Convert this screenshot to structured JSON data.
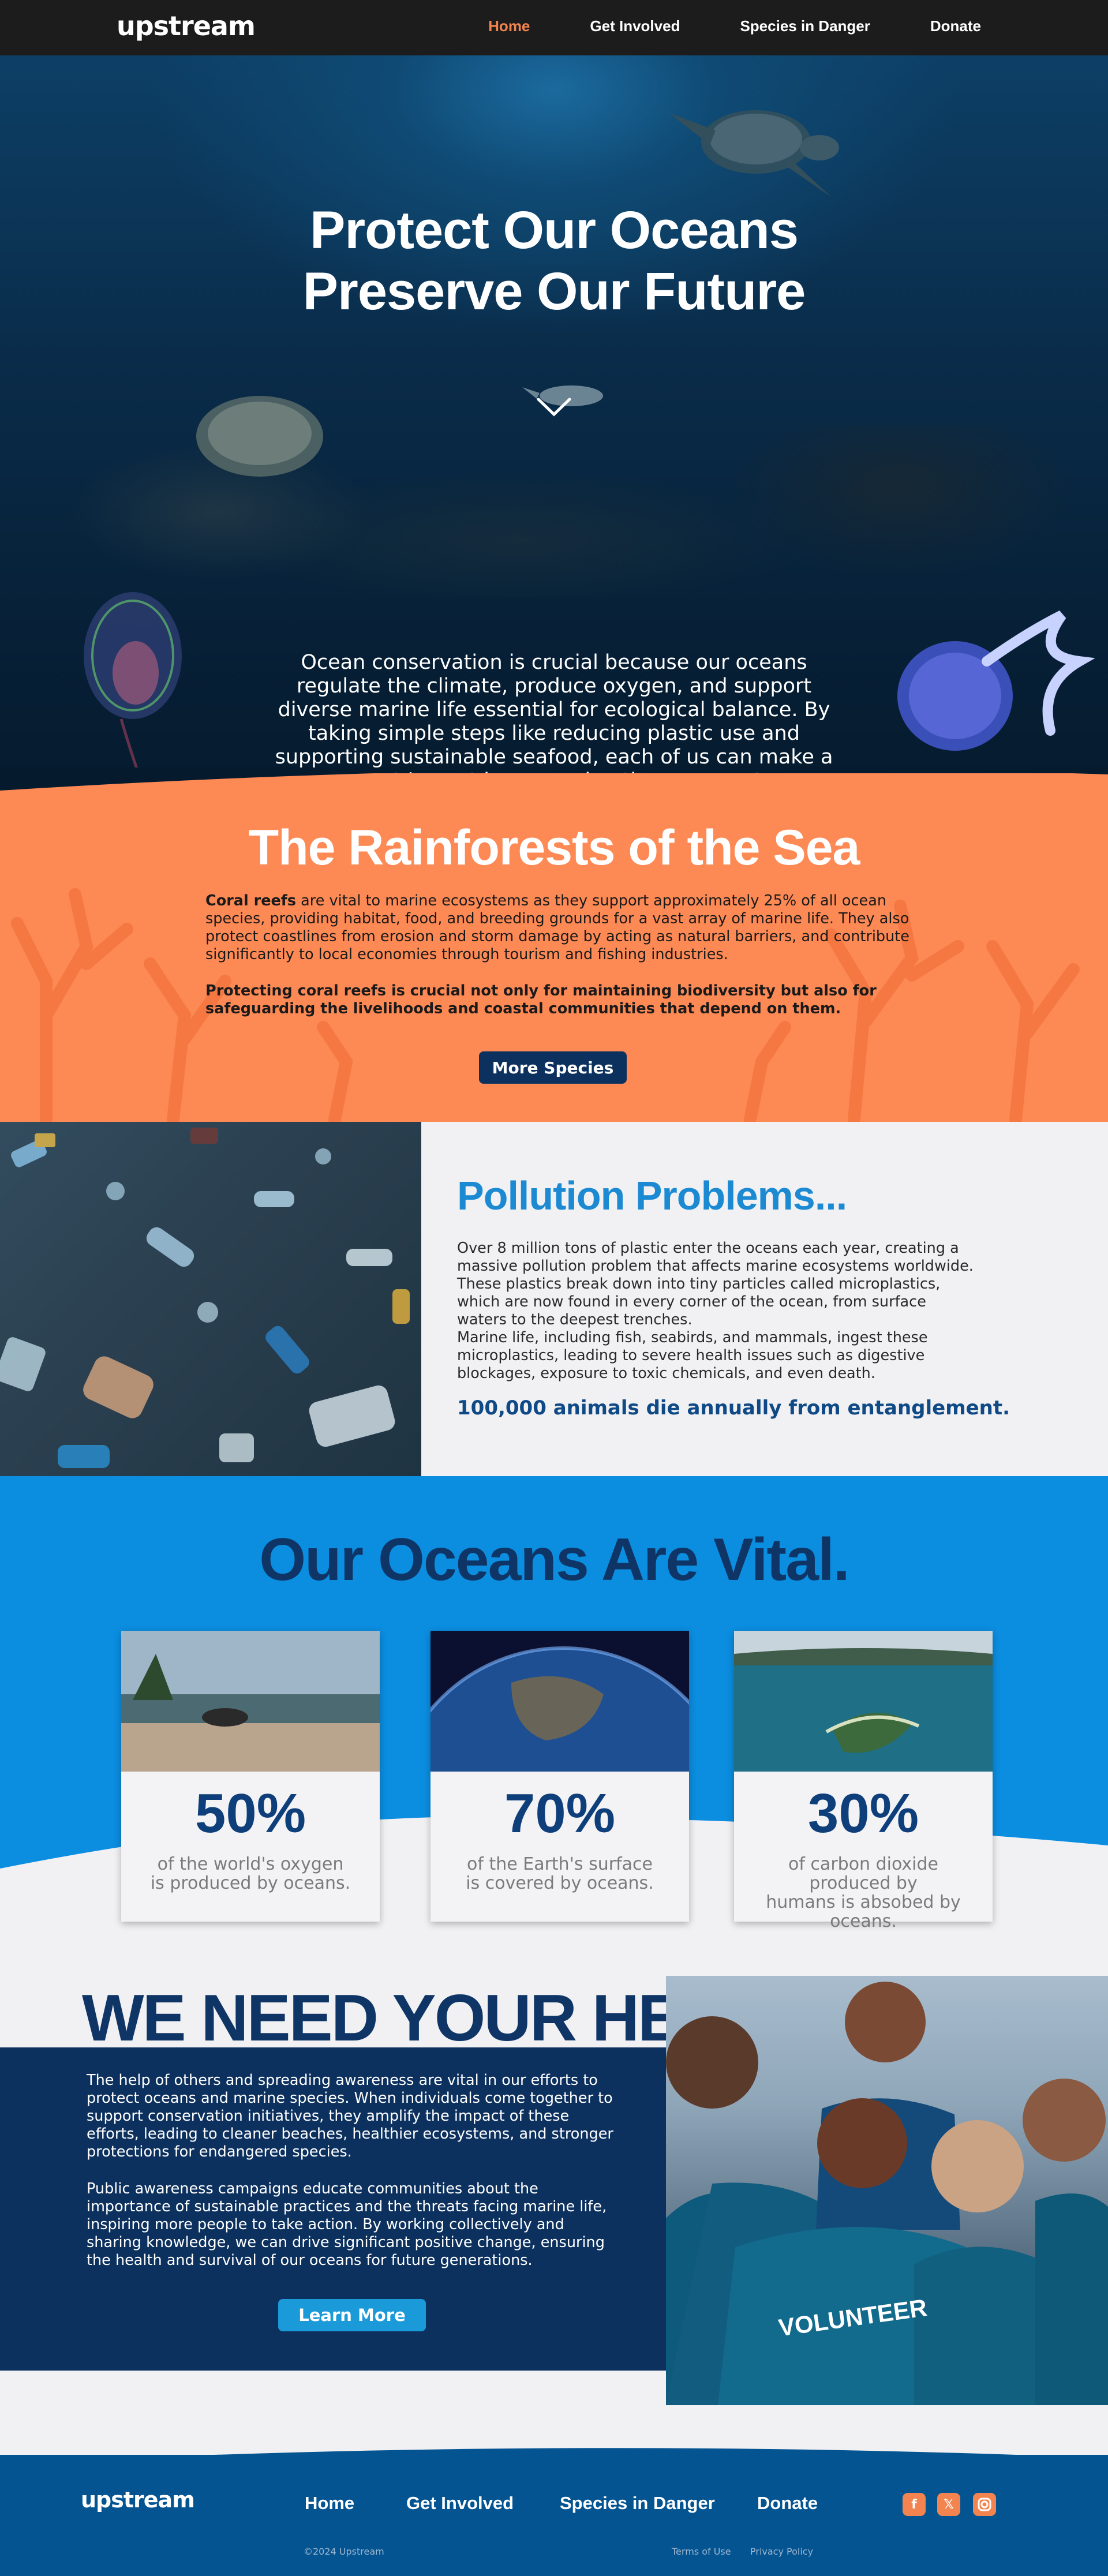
{
  "nav": {
    "logo": "upstream",
    "items": [
      {
        "label": "Home",
        "active": true
      },
      {
        "label": "Get Involved"
      },
      {
        "label": "Species in Danger"
      },
      {
        "label": "Donate"
      }
    ]
  },
  "hero": {
    "title_line1": "Protect Our Oceans",
    "title_line2": "Preserve Our Future",
    "text": "Ocean conservation is crucial because our oceans regulate the climate, produce oxygen, and support diverse marine life essential for ecological balance. By taking simple steps like reducing plastic use and supporting sustainable seafood, each of us can make a significant impact in preserving these ecosystems."
  },
  "coral": {
    "title": "The Rainforests of the Sea",
    "p1_bold": "Coral reefs",
    "p1_rest": " are vital to marine ecosystems as they support approximately 25% of all ocean species, providing habitat, food, and breeding grounds for a vast array of marine life. They also protect coastlines from erosion and storm damage by acting as natural barriers, and contribute significantly to local economies through tourism and fishing industries.",
    "p2": "Protecting coral reefs is crucial not only for maintaining biodiversity but also for safeguarding the livelihoods and coastal communities that depend on them.",
    "button": "More Species"
  },
  "pollution": {
    "title": "Pollution Problems...",
    "p1": "Over 8 million tons of plastic enter the oceans each year, creating a massive pollution problem that affects marine ecosystems worldwide. These plastics break down into tiny particles called microplastics, which are now found in every corner of the ocean, from surface waters to the deepest trenches.",
    "p2": "Marine life, including fish, seabirds, and mammals, ingest these microplastics, leading to severe health issues such as digestive blockages, exposure to toxic chemicals, and even death.",
    "highlight": "100,000 animals die annually from entanglement."
  },
  "oceans": {
    "title": "Our Oceans Are Vital.",
    "cards": [
      {
        "stat": "50%",
        "line1": "of the world's oxygen",
        "line2": "is produced by oceans."
      },
      {
        "stat": "70%",
        "line1": "of the Earth's surface",
        "line2": "is covered by oceans."
      },
      {
        "stat": "30%",
        "line1": "of carbon dioxide produced by",
        "line2": "humans is absobed by oceans."
      }
    ]
  },
  "help": {
    "title": "WE NEED YOUR HELP",
    "p1": "The help of others and spreading awareness are vital in our efforts to protect oceans and marine species. When individuals come together to support conservation initiatives, they amplify the impact of these efforts, leading to cleaner beaches, healthier ecosystems, and stronger protections for endangered species.",
    "p2": "Public awareness campaigns educate communities about the importance of sustainable practices and the threats facing marine life, inspiring more people to take action. By working collectively and sharing knowledge, we can drive significant positive change, ensuring the health and survival of our oceans for future generations.",
    "button": "Learn More",
    "shirt_text": "VOLUNTEER"
  },
  "footer": {
    "logo": "upstream",
    "links": [
      "Home",
      "Get Involved",
      "Species in Danger",
      "Donate"
    ],
    "copyright": "©2024 Upstream",
    "terms": "Terms of Use",
    "privacy": "Privacy Policy",
    "social_icons": [
      "facebook-icon",
      "x-icon",
      "instagram-icon"
    ]
  },
  "colors": {
    "accent_orange": "#f4844f",
    "navy": "#0d315f",
    "ocean_blue": "#0b8de0",
    "pollution_blue": "#1c8ad3"
  }
}
